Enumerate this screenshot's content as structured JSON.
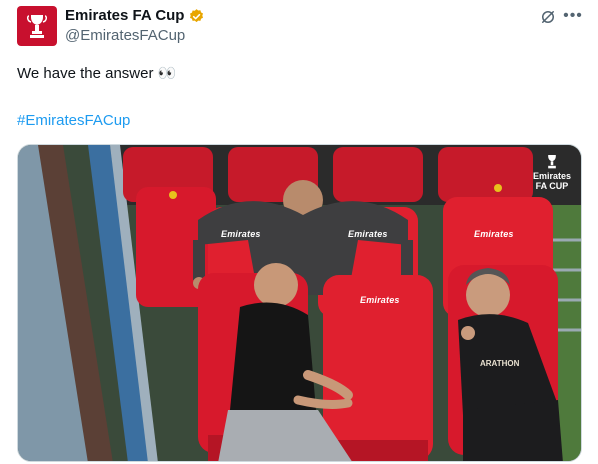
{
  "account": {
    "display_name": "Emirates FA Cup",
    "handle": "@EmiratesFACup",
    "verified_color": "#e8a600",
    "avatar_color": "#c8102e"
  },
  "tweet": {
    "text": "We have the answer 👀",
    "hashtag": "#EmiratesFACup"
  },
  "media": {
    "watermark_line1": "Emirates",
    "watermark_line2": "FA CUP",
    "seat_branding": "Emirates",
    "jacket_text": "ARATHON"
  },
  "icons": {
    "grok": "grok-icon",
    "more": "more-dots-icon",
    "verified": "verified-badge-icon"
  },
  "colors": {
    "seat_red": "#d7192c",
    "link_blue": "#1d9bf0"
  }
}
